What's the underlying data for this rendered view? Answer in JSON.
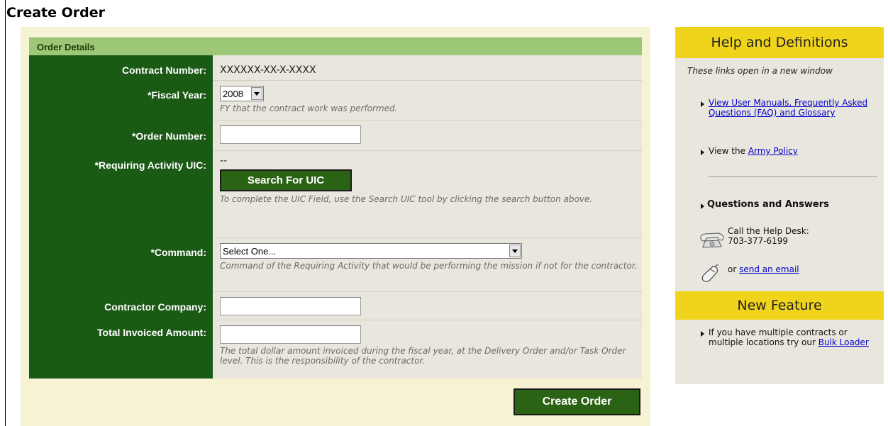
{
  "page": {
    "title": "Create Order"
  },
  "form": {
    "section_title": "Order Details",
    "contract_number": {
      "label": "Contract Number:",
      "value": "XXXXXX-XX-X-XXXX"
    },
    "fiscal_year": {
      "label": "*Fiscal Year:",
      "value": "2008",
      "hint": "FY that the contract work was performed."
    },
    "order_number": {
      "label": "*Order Number:",
      "value": ""
    },
    "uic": {
      "label": "*Requiring Activity UIC:",
      "value": "--",
      "button": "Search For UIC",
      "hint": "To complete the UIC Field, use the Search UIC tool by clicking the search button above."
    },
    "command": {
      "label": "*Command:",
      "value": "Select One...",
      "hint": "Command of the Requiring Activity that would be performing the mission if not for the contractor."
    },
    "contractor_company": {
      "label": "Contractor Company:",
      "value": ""
    },
    "total_invoiced": {
      "label": "Total Invoiced Amount:",
      "value": "",
      "hint": "The total dollar amount invoiced during the fiscal year, at the Delivery Order and/or Task Order level. This is the responsibility of the contractor."
    },
    "submit": "Create Order"
  },
  "sidebar": {
    "help_title": "Help and Definitions",
    "help_note": "These links open in a new window",
    "manuals_link": "View User Manuals, Frequently Asked Questions (FAQ) and Glossary",
    "policy_prefix": "View the ",
    "policy_link": "Army Policy",
    "qa_title": "Questions and Answers",
    "call_text": "Call the Help Desk:",
    "phone": "703-377-6199",
    "email_prefix": "or ",
    "email_link": "send an email",
    "feature_title": "New Feature",
    "feature_text": "If you have multiple contracts or multiple locations try our ",
    "feature_link": "Bulk Loader",
    "icons": {
      "phone": "telephone-icon",
      "mouse": "mouse-icon",
      "bullet": "triangle-bullet-icon"
    }
  },
  "colors": {
    "label_bg": "#1a5a15",
    "header_green": "#9bc776",
    "button_green": "#2b6314",
    "side_header_yellow": "#f0d41b",
    "panel_cream": "#f6f3d4",
    "link": "#0000cc"
  }
}
